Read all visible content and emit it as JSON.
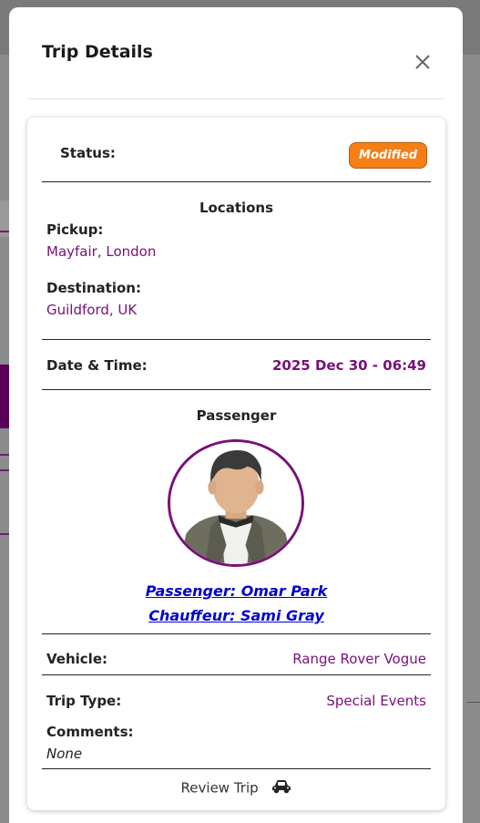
{
  "modal": {
    "title": "Trip Details"
  },
  "status": {
    "label": "Status:",
    "badge": "Modified",
    "badge_color": "#f57f17"
  },
  "locations": {
    "section_title": "Locations",
    "pickup_label": "Pickup:",
    "pickup_value": "Mayfair, London",
    "destination_label": "Destination:",
    "destination_value": "Guildford, UK"
  },
  "datetime": {
    "label": "Date & Time:",
    "value": "2025 Dec 30 - 06:49"
  },
  "passenger": {
    "section_title": "Passenger",
    "passenger_link": "Passenger: Omar Park",
    "chauffeur_link": "Chauffeur: Sami Gray"
  },
  "vehicle": {
    "label": "Vehicle:",
    "value": "Range Rover Vogue"
  },
  "trip_type": {
    "label": "Trip Type:",
    "value": "Special Events"
  },
  "comments": {
    "label": "Comments:",
    "value": "None"
  },
  "footer": {
    "review_label": "Review Trip",
    "icon": "car-icon"
  },
  "colors": {
    "accent": "#7a0f7a",
    "link": "#0000cc"
  }
}
